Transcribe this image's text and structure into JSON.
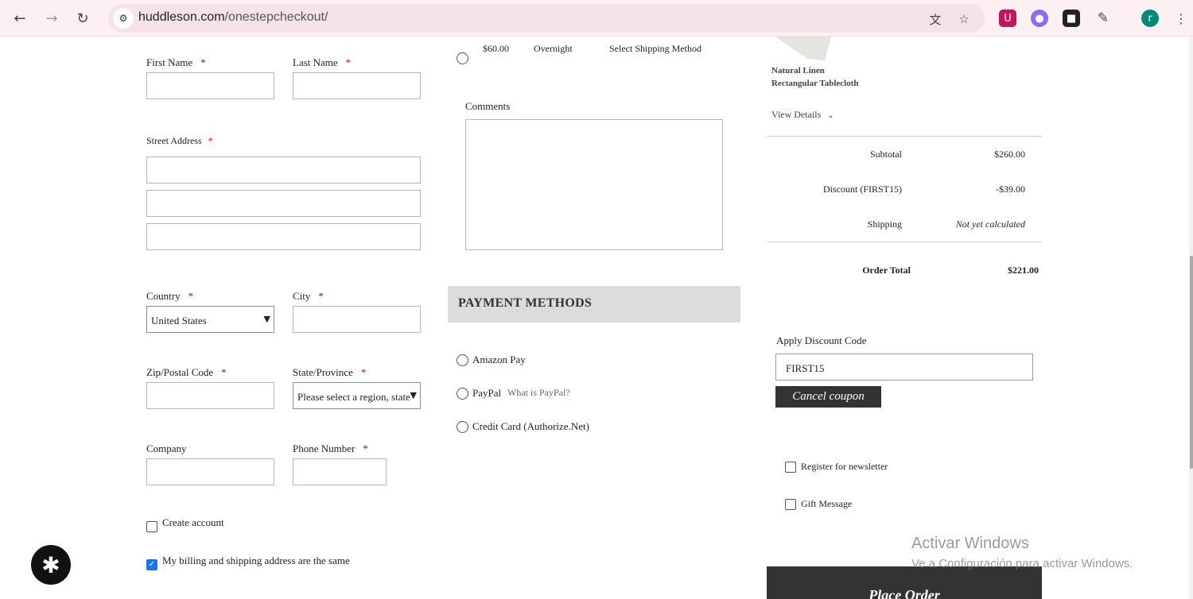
{
  "browser": {
    "url_host": "huddleson.com",
    "url_path": "/onestepcheckout/",
    "profile_initial": "r"
  },
  "billing": {
    "first_name_label": "First Name",
    "last_name_label": "Last Name",
    "street_label": "Street Address",
    "country_label": "Country",
    "country_value": "United States",
    "city_label": "City",
    "zip_label": "Zip/Postal Code",
    "state_label": "State/Province",
    "state_placeholder": "Please select a region, state",
    "company_label": "Company",
    "phone_label": "Phone Number",
    "required_mark": "*",
    "create_account_label": "Create account",
    "same_address_label": "My billing and shipping address are the same"
  },
  "shipping": {
    "price": "$60.00",
    "method": "Overnight",
    "carrier": "Select Shipping Method"
  },
  "comments_label": "Comments",
  "payment": {
    "heading": "PAYMENT METHODS",
    "options": [
      "Amazon Pay",
      "PayPal",
      "Credit Card (Authorize.Net)"
    ],
    "paypal_link": "What is PayPal?"
  },
  "summary": {
    "product_name_line1": "Natural Linen",
    "product_name_line2": "Rectangular Tablecloth",
    "view_details": "View Details",
    "subtotal_label": "Subtotal",
    "subtotal_value": "$260.00",
    "discount_label": "Discount (FIRST15)",
    "discount_value": "-$39.00",
    "shipping_label": "Shipping",
    "shipping_value": "Not yet calculated",
    "total_label": "Order Total",
    "total_value": "$221.00",
    "discount_code_label": "Apply Discount Code",
    "discount_code_value": "FIRST15",
    "cancel_coupon": "Cancel coupon",
    "newsletter_label": "Register for newsletter",
    "gift_label": "Gift Message",
    "place_order": "Place Order"
  },
  "watermark": {
    "line1": "Activar Windows",
    "line2": "Ve a Configuración para activar Windows."
  },
  "colors": {
    "dark_button": "#333333",
    "required": "#cc0000",
    "payment_header_bg": "#dcdcdc",
    "checkbox_checked": "#1a73e8"
  }
}
